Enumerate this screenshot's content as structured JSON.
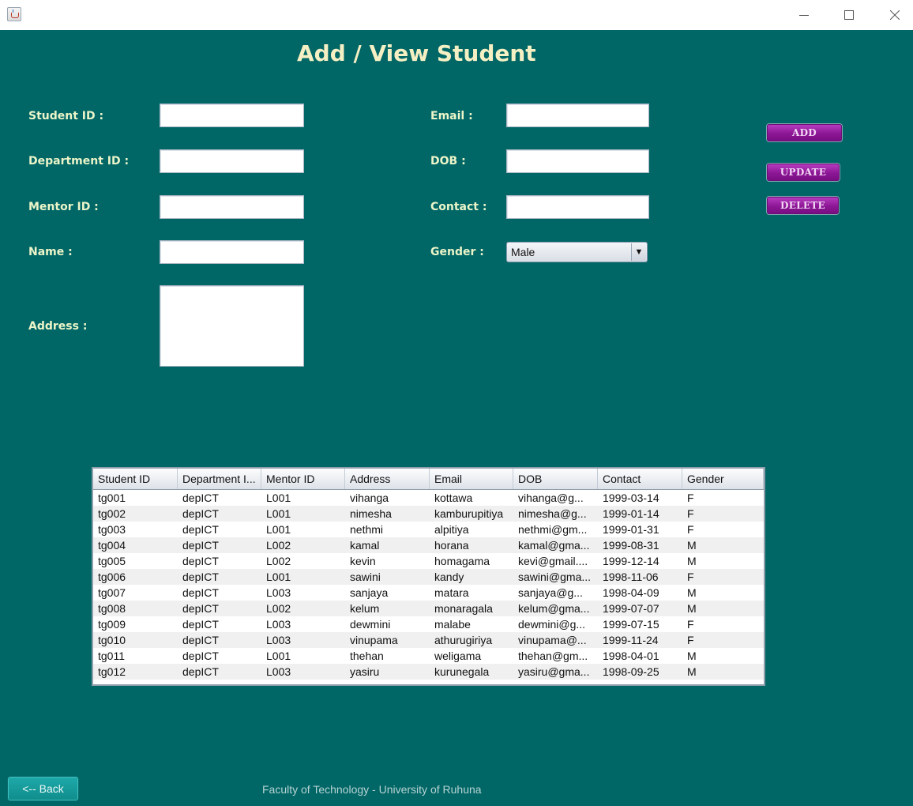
{
  "window": {
    "title": ""
  },
  "header": {
    "title": "Add / View Student"
  },
  "form": {
    "student_id": {
      "label": "Student ID :",
      "value": ""
    },
    "department_id": {
      "label": "Department ID :",
      "value": ""
    },
    "mentor_id": {
      "label": "Mentor ID :",
      "value": ""
    },
    "name": {
      "label": "Name :",
      "value": ""
    },
    "address": {
      "label": "Address :",
      "value": ""
    },
    "email": {
      "label": "Email :",
      "value": ""
    },
    "dob": {
      "label": "DOB :",
      "value": ""
    },
    "contact": {
      "label": "Contact :",
      "value": ""
    },
    "gender": {
      "label": "Gender :",
      "selected": "Male"
    }
  },
  "actions": {
    "add": "ADD",
    "update": "UPDATE",
    "delete": "DELETE"
  },
  "table": {
    "columns": [
      "Student ID",
      "Department I...",
      "Mentor ID",
      "Address",
      "Email",
      "DOB",
      "Contact",
      "Gender"
    ],
    "rows": [
      [
        "tg001",
        "depICT",
        "L001",
        "vihanga",
        "kottawa",
        "vihanga@g...",
        "1999-03-14",
        "F"
      ],
      [
        "tg002",
        "depICT",
        "L001",
        "nimesha",
        "kamburupitiya",
        "nimesha@g...",
        "1999-01-14",
        "F"
      ],
      [
        "tg003",
        "depICT",
        "L001",
        "nethmi",
        "alpitiya",
        "nethmi@gm...",
        "1999-01-31",
        "F"
      ],
      [
        "tg004",
        "depICT",
        "L002",
        "kamal",
        "horana",
        "kamal@gma...",
        "1999-08-31",
        "M"
      ],
      [
        "tg005",
        "depICT",
        "L002",
        "kevin",
        "homagama",
        "kevi@gmail....",
        "1999-12-14",
        "M"
      ],
      [
        "tg006",
        "depICT",
        "L001",
        "sawini",
        "kandy",
        "sawini@gma...",
        "1998-11-06",
        "F"
      ],
      [
        "tg007",
        "depICT",
        "L003",
        "sanjaya",
        "matara",
        "sanjaya@g...",
        "1998-04-09",
        "M"
      ],
      [
        "tg008",
        "depICT",
        "L002",
        "kelum",
        "monaragala",
        "kelum@gma...",
        "1999-07-07",
        "M"
      ],
      [
        "tg009",
        "depICT",
        "L003",
        "dewmini",
        "malabe",
        "dewmini@g...",
        "1999-07-15",
        "F"
      ],
      [
        "tg010",
        "depICT",
        "L003",
        "vinupama",
        "athurugiriya",
        "vinupama@...",
        "1999-11-24",
        "F"
      ],
      [
        "tg011",
        "depICT",
        "L001",
        "thehan",
        "weligama",
        "thehan@gm...",
        "1998-04-01",
        "M"
      ],
      [
        "tg012",
        "depICT",
        "L003",
        "yasiru",
        "kurunegala",
        "yasiru@gma...",
        "1998-09-25",
        "M"
      ]
    ]
  },
  "footer": {
    "back": "<-- Back",
    "credit": "Faculty of Technology - University of Ruhuna"
  },
  "colors": {
    "background": "#006666",
    "title": "#f5f0c4",
    "label": "#ecf5c9",
    "action_button": "#8c1795",
    "back_button": "#1a9e9e"
  },
  "icons": {
    "app": "java-cup-icon",
    "minimize": "minimize-icon",
    "maximize": "maximize-icon",
    "close": "close-icon",
    "dropdown": "dropdown-arrow-icon"
  }
}
